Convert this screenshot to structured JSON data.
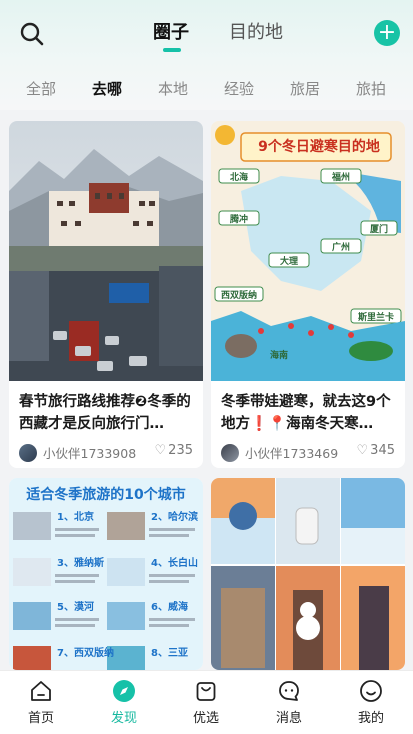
{
  "header": {
    "tabs": [
      {
        "label": "圈子",
        "active": true
      },
      {
        "label": "目的地",
        "active": false
      }
    ],
    "add_label": "+"
  },
  "subtabs": [
    {
      "label": "全部",
      "active": false
    },
    {
      "label": "去哪",
      "active": true
    },
    {
      "label": "本地",
      "active": false
    },
    {
      "label": "经验",
      "active": false
    },
    {
      "label": "旅居",
      "active": false
    },
    {
      "label": "旅拍",
      "active": false
    }
  ],
  "cards": [
    {
      "title": "春节旅行路线推荐❷冬季的西藏才是反向旅行门…",
      "author": "小伙伴1733908",
      "likes": "235"
    },
    {
      "title": "冬季带娃避寒，就去这9个地方❗📍海南冬天寒…",
      "author": "小伙伴1733469",
      "likes": "345",
      "poster": {
        "headline": "9个冬日避寒目的地",
        "places": [
          "北海",
          "福州",
          "腾冲",
          "厦门",
          "大理",
          "广州",
          "西双版纳",
          "斯里兰卡",
          "海南"
        ]
      }
    },
    {
      "poster": {
        "headline": "适合冬季旅游的10个城市",
        "items": [
          "1、北京",
          "2、哈尔滨",
          "3、雅纳斯",
          "4、长白山",
          "5、漠河",
          "6、威海",
          "7、西双版纳",
          "8、三亚"
        ]
      }
    },
    {}
  ],
  "bottom_nav": [
    {
      "label": "首页",
      "icon": "home-icon",
      "active": false
    },
    {
      "label": "发现",
      "icon": "compass-icon",
      "active": true
    },
    {
      "label": "优选",
      "icon": "bag-icon",
      "active": false
    },
    {
      "label": "消息",
      "icon": "message-icon",
      "active": false
    },
    {
      "label": "我的",
      "icon": "profile-icon",
      "active": false
    }
  ],
  "colors": {
    "accent": "#16c1a8",
    "background": "#f2f3f5"
  }
}
